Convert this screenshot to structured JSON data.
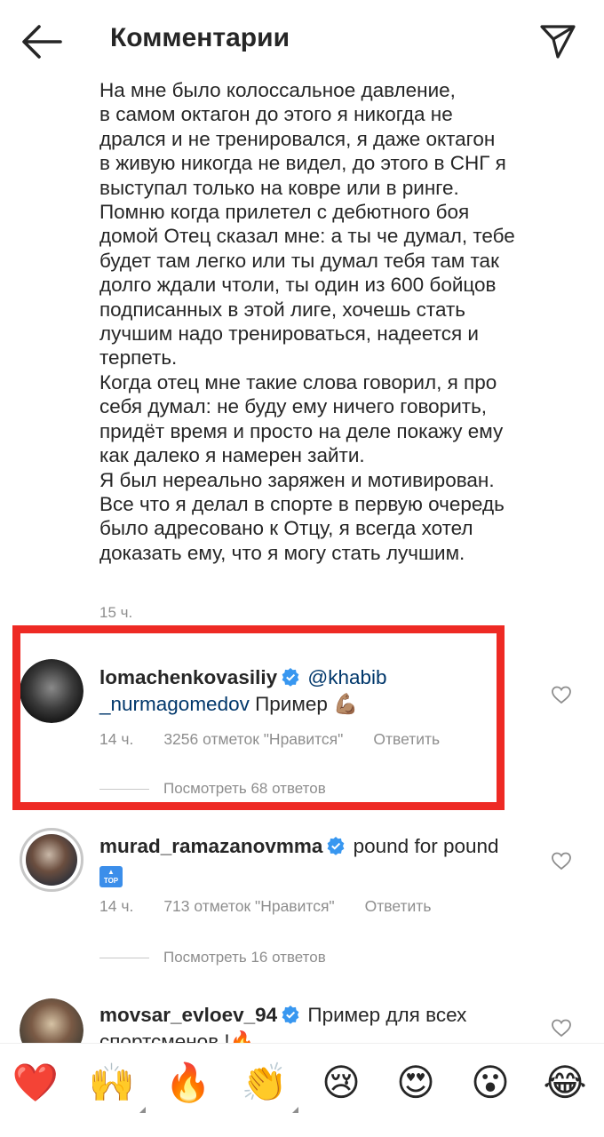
{
  "header": {
    "title": "Комментарии"
  },
  "caption": {
    "text": "На мне было колоссальное давление,\nв самом октагон до этого я никогда не\nдрался и не тренировался, я даже октагон\nв живую никогда не видел, до этого в СНГ я\nвыступал только на ковре или в ринге.\nПомню когда прилетел с дебютного боя\nдомой Отец сказал мне: а ты че думал, тебе\nбудет там легко или ты думал тебя там так\nдолго ждали чтоли, ты один из 600 бойцов\nподписанных в этой лиге, хочешь стать\nлучшим надо тренироваться, надеется и\nтерпеть.\nКогда отец мне такие слова говорил, я про\nсебя думал: не буду ему ничего говорить,\nпридёт время и просто на деле покажу ему\nкак далеко я намерен зайти.\nЯ был нереально заряжен и мотивирован.\nВсе что я делал в спорте в первую очередь\nбыло адресовано к Отцу, я всегда хотел\nдоказать ему, что я могу стать лучшим.",
    "time": "15 ч."
  },
  "comments": [
    {
      "username": "lomachenkovasiliy",
      "mention_line1": "@khabib",
      "mention_line2": "_nurmagomedov",
      "text": "Пример 💪🏽",
      "time": "14 ч.",
      "likes": "3256 отметок \"Нравится\"",
      "reply": "Ответить",
      "view_replies": "Посмотреть 68 ответов"
    },
    {
      "username": "murad_ramazanovmma",
      "text": "pound for pound",
      "badge": "TOP",
      "time": "14 ч.",
      "likes": "713 отметок \"Нравится\"",
      "reply": "Ответить",
      "view_replies": "Посмотреть 16 ответов"
    },
    {
      "username": "movsar_evloev_94",
      "text": "Пример для всех",
      "text2": "спортсменов !🔥"
    }
  ],
  "emoji_bar": [
    "❤️",
    "🙌",
    "🔥",
    "👏",
    "😢",
    "😍",
    "😮",
    "😂"
  ],
  "colors": {
    "highlight": "#ee2a24",
    "verified": "#3897f0",
    "mention": "#00376b",
    "muted": "#8e8e8e"
  }
}
